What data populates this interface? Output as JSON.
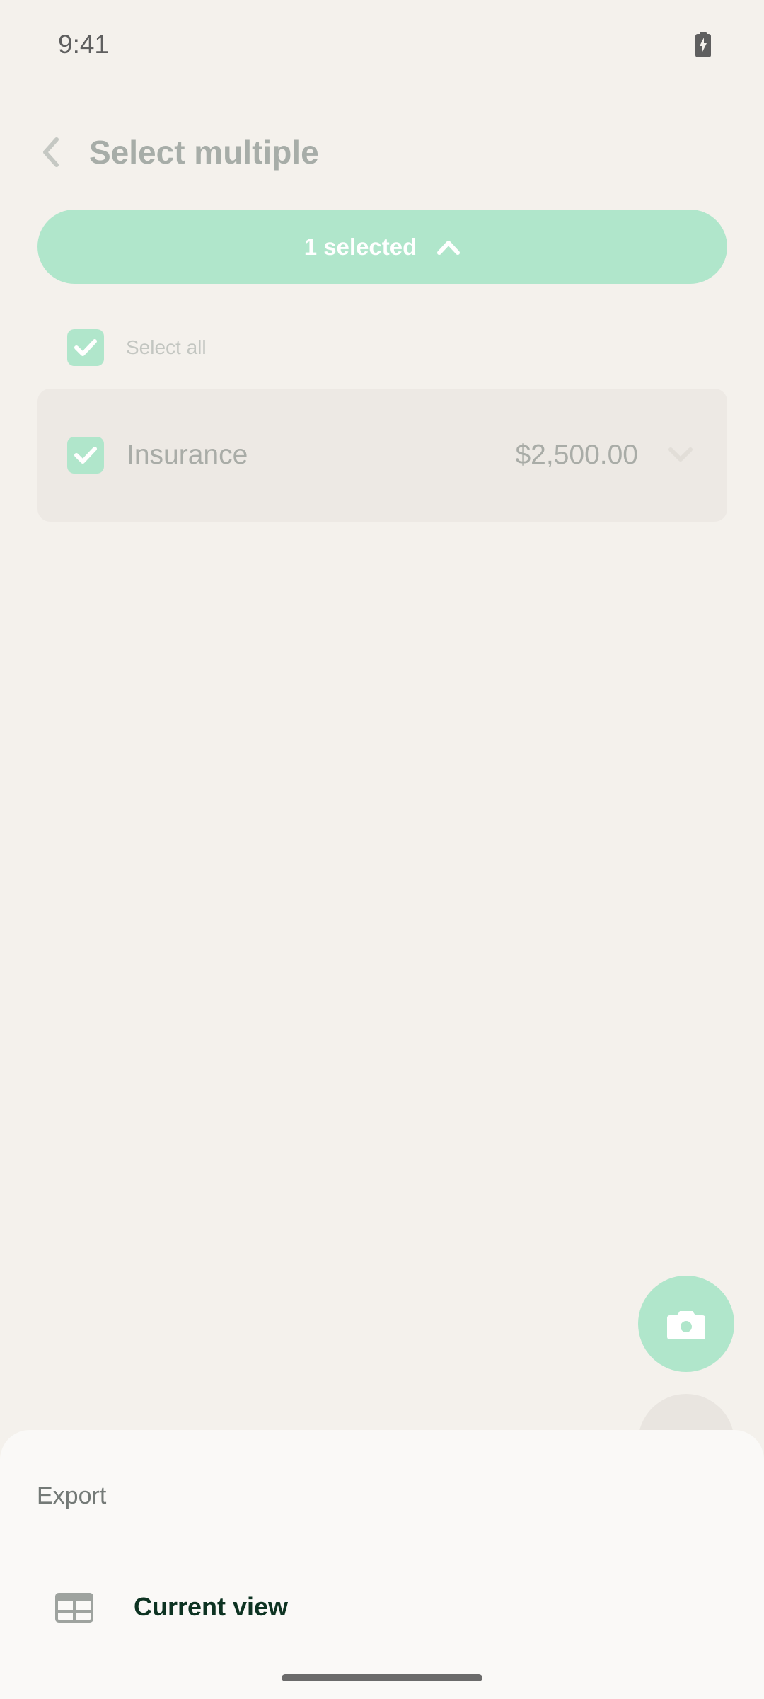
{
  "status_bar": {
    "time": "9:41",
    "battery_icon": "battery-charging-icon"
  },
  "header": {
    "back_icon": "chevron-left-icon",
    "title": "Select multiple"
  },
  "selection_pill": {
    "label": "1 selected",
    "icon": "chevron-up-icon"
  },
  "select_all": {
    "label": "Select all",
    "checked": true
  },
  "items": [
    {
      "label": "Insurance",
      "amount": "$2,500.00",
      "checked": true,
      "icon": "chevron-down-icon"
    }
  ],
  "fab": {
    "icon": "camera-icon"
  },
  "export_sheet": {
    "title": "Export",
    "options": [
      {
        "label": "Current view",
        "icon": "table-icon"
      }
    ]
  },
  "colors": {
    "background": "#f4f1ec",
    "accent_mint": "#b0e6cb",
    "sheet_background": "#faf9f7",
    "option_text": "#0d3322"
  }
}
